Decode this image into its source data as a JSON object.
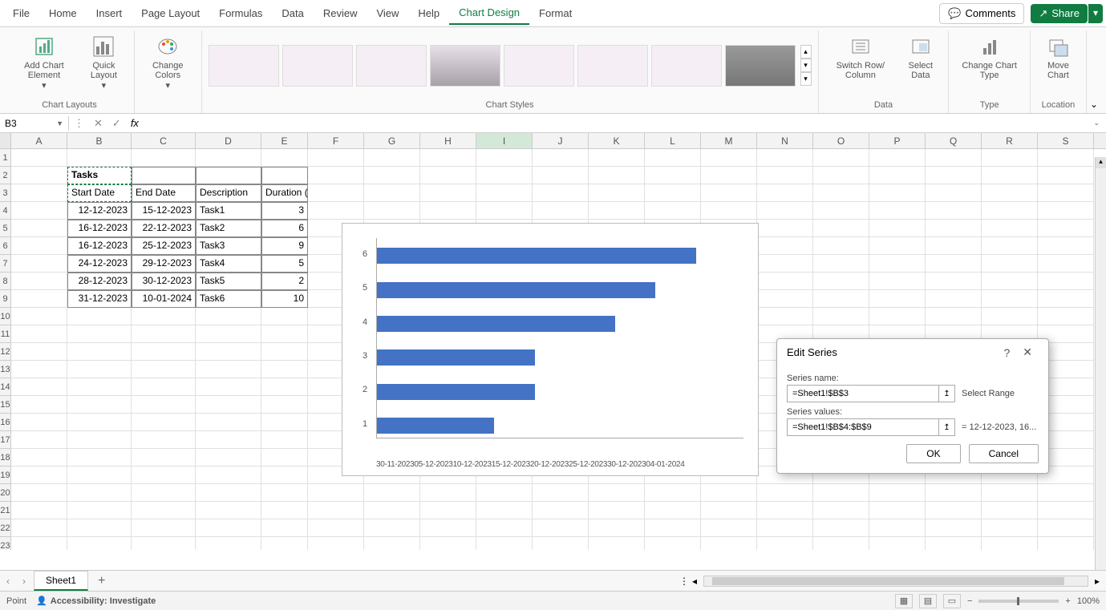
{
  "menu": {
    "tabs": [
      "File",
      "Home",
      "Insert",
      "Page Layout",
      "Formulas",
      "Data",
      "Review",
      "View",
      "Help",
      "Chart Design",
      "Format"
    ],
    "active": "Chart Design",
    "comments": "Comments",
    "share": "Share"
  },
  "ribbon": {
    "chart_layouts": {
      "label": "Chart Layouts",
      "add_element": "Add Chart Element",
      "quick_layout": "Quick Layout"
    },
    "change_colors": "Change Colors",
    "chart_styles": "Chart Styles",
    "data": {
      "label": "Data",
      "switch": "Switch Row/ Column",
      "select": "Select Data"
    },
    "type": {
      "label": "Type",
      "change": "Change Chart Type"
    },
    "location": {
      "label": "Location",
      "move": "Move Chart"
    }
  },
  "formula_bar": {
    "name_box": "B3",
    "formula": ""
  },
  "columns": [
    "A",
    "B",
    "C",
    "D",
    "E",
    "F",
    "G",
    "H",
    "I",
    "J",
    "K",
    "L",
    "M",
    "N",
    "O",
    "P",
    "Q",
    "R",
    "S"
  ],
  "table": {
    "title": "Tasks",
    "headers": {
      "b": "Start Date",
      "c": "End Date",
      "d": "Description",
      "e": "Duration (days)"
    },
    "rows": [
      {
        "b": "12-12-2023",
        "c": "15-12-2023",
        "d": "Task1",
        "e": "3"
      },
      {
        "b": "16-12-2023",
        "c": "22-12-2023",
        "d": "Task2",
        "e": "6"
      },
      {
        "b": "16-12-2023",
        "c": "25-12-2023",
        "d": "Task3",
        "e": "9"
      },
      {
        "b": "24-12-2023",
        "c": "29-12-2023",
        "d": "Task4",
        "e": "5"
      },
      {
        "b": "28-12-2023",
        "c": "30-12-2023",
        "d": "Task5",
        "e": "2"
      },
      {
        "b": "31-12-2023",
        "c": "10-01-2024",
        "d": "Task6",
        "e": "10"
      }
    ]
  },
  "chart_data": {
    "type": "bar",
    "categories": [
      "1",
      "2",
      "3",
      "4",
      "5",
      "6"
    ],
    "series": [
      {
        "name": "Start Date",
        "values": [
          "12-12-2023",
          "16-12-2023",
          "16-12-2023",
          "24-12-2023",
          "28-12-2023",
          "31-12-2023"
        ]
      }
    ],
    "x_ticks": [
      "30-11-2023",
      "05-12-2023",
      "10-12-2023",
      "15-12-2023",
      "20-12-2023",
      "25-12-2023",
      "30-12-2023",
      "04-01-2024"
    ],
    "bar_widths_pct": [
      32,
      43,
      43,
      65,
      76,
      87
    ]
  },
  "dialog": {
    "title": "Edit Series",
    "name_label": "Series name:",
    "name_value": "=Sheet1!$B$3",
    "name_hint": "Select Range",
    "values_label": "Series values:",
    "values_value": "=Sheet1!$B$4:$B$9",
    "values_hint": "= 12-12-2023, 16...",
    "ok": "OK",
    "cancel": "Cancel"
  },
  "sheet": {
    "name": "Sheet1"
  },
  "status": {
    "mode": "Point",
    "accessibility": "Accessibility: Investigate",
    "zoom": "100%"
  }
}
